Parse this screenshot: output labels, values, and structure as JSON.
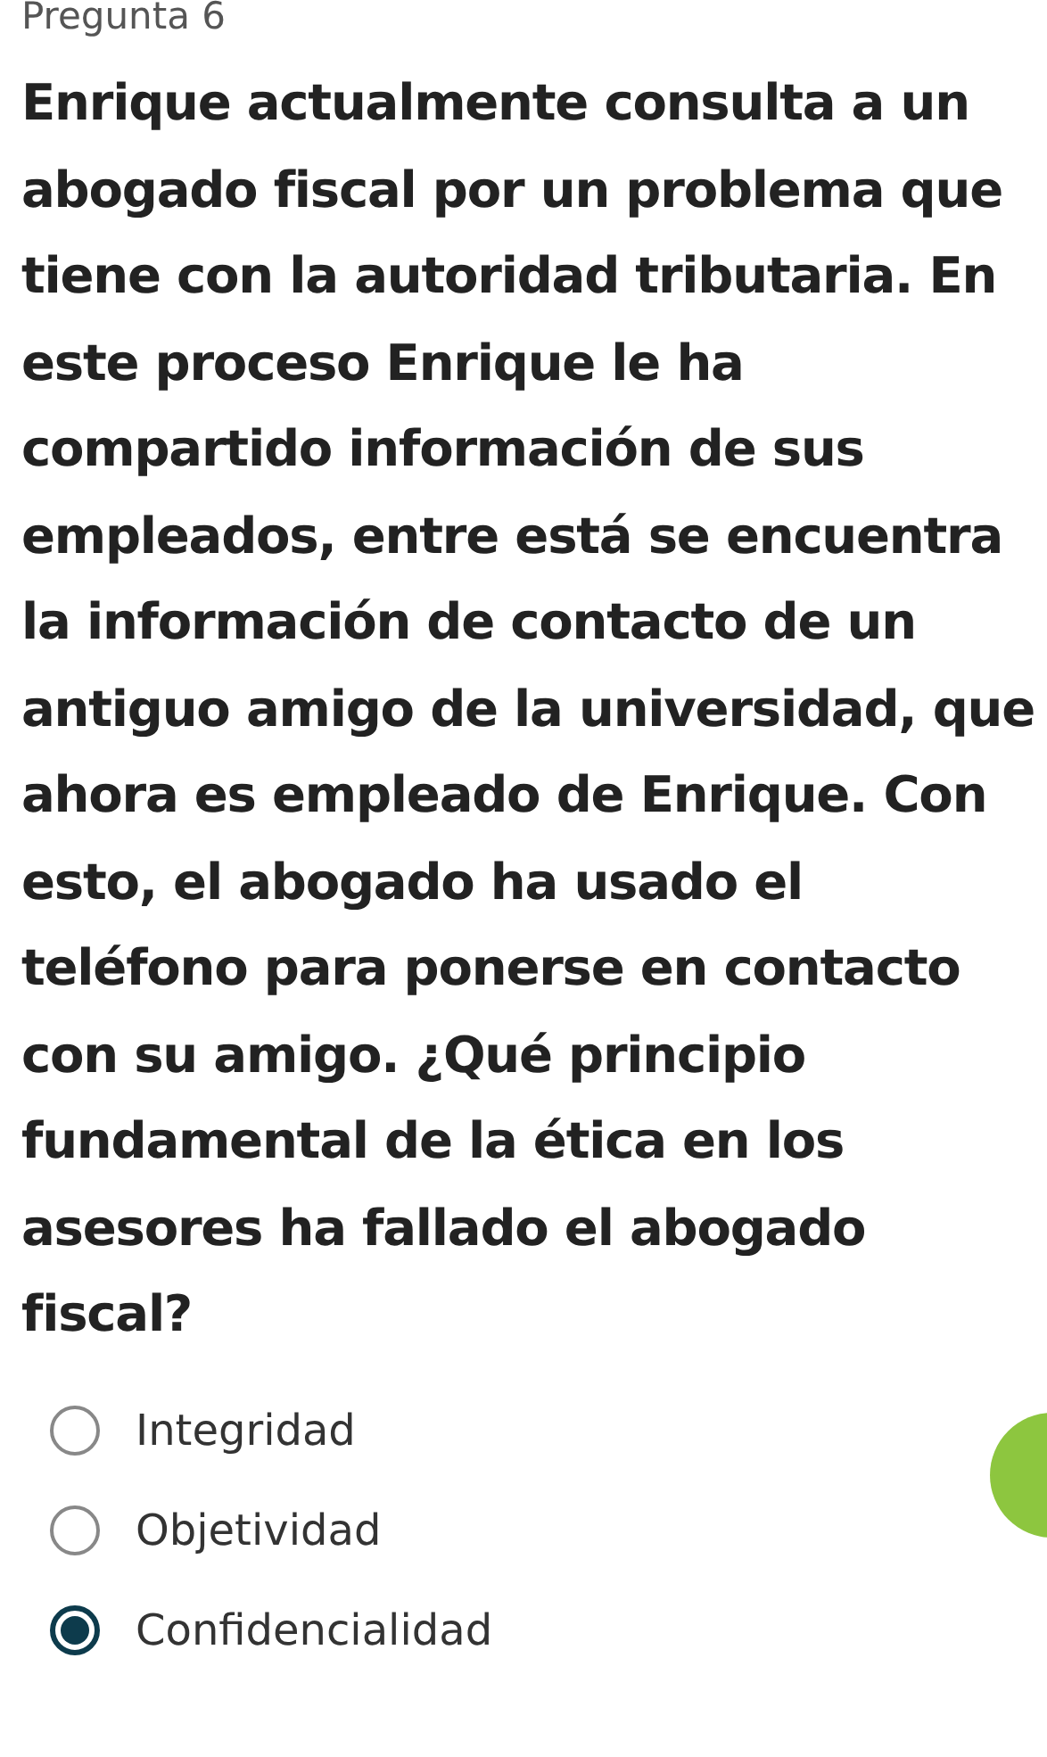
{
  "header": {
    "title": "Pregunta 6"
  },
  "question": "Enrique actualmente consulta a un abogado fiscal por un problema que tiene con la autoridad tributaria. En este proceso Enrique le ha compartido información de sus empleados, entre está se encuentra la información de contacto de un antiguo amigo de la universidad, que ahora es empleado de Enrique. Con esto, el abogado ha usado el teléfono para ponerse en contacto con su amigo. ¿Qué principio fundamental de la ética en los asesores ha fallado el abogado fiscal?",
  "options": [
    {
      "label": "Integridad",
      "selected": false
    },
    {
      "label": "Objetividad",
      "selected": false
    },
    {
      "label": "Confidencialidad",
      "selected": true
    }
  ]
}
